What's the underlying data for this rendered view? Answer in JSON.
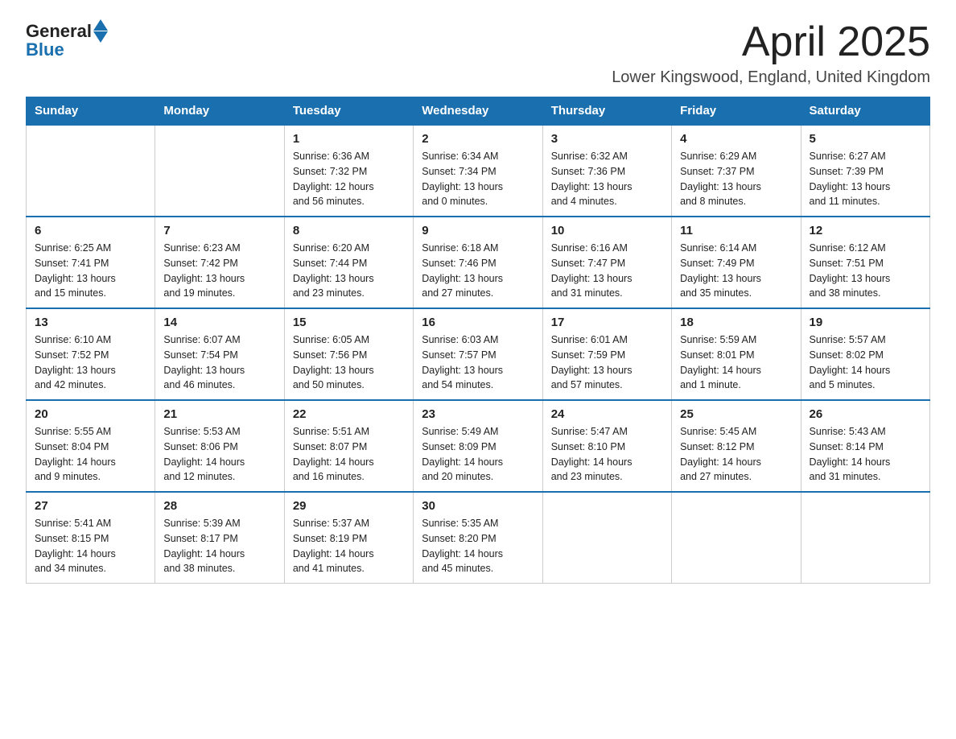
{
  "logo": {
    "general": "General",
    "blue": "Blue"
  },
  "title": "April 2025",
  "location": "Lower Kingswood, England, United Kingdom",
  "weekdays": [
    "Sunday",
    "Monday",
    "Tuesday",
    "Wednesday",
    "Thursday",
    "Friday",
    "Saturday"
  ],
  "weeks": [
    [
      {
        "day": "",
        "info": ""
      },
      {
        "day": "",
        "info": ""
      },
      {
        "day": "1",
        "info": "Sunrise: 6:36 AM\nSunset: 7:32 PM\nDaylight: 12 hours\nand 56 minutes."
      },
      {
        "day": "2",
        "info": "Sunrise: 6:34 AM\nSunset: 7:34 PM\nDaylight: 13 hours\nand 0 minutes."
      },
      {
        "day": "3",
        "info": "Sunrise: 6:32 AM\nSunset: 7:36 PM\nDaylight: 13 hours\nand 4 minutes."
      },
      {
        "day": "4",
        "info": "Sunrise: 6:29 AM\nSunset: 7:37 PM\nDaylight: 13 hours\nand 8 minutes."
      },
      {
        "day": "5",
        "info": "Sunrise: 6:27 AM\nSunset: 7:39 PM\nDaylight: 13 hours\nand 11 minutes."
      }
    ],
    [
      {
        "day": "6",
        "info": "Sunrise: 6:25 AM\nSunset: 7:41 PM\nDaylight: 13 hours\nand 15 minutes."
      },
      {
        "day": "7",
        "info": "Sunrise: 6:23 AM\nSunset: 7:42 PM\nDaylight: 13 hours\nand 19 minutes."
      },
      {
        "day": "8",
        "info": "Sunrise: 6:20 AM\nSunset: 7:44 PM\nDaylight: 13 hours\nand 23 minutes."
      },
      {
        "day": "9",
        "info": "Sunrise: 6:18 AM\nSunset: 7:46 PM\nDaylight: 13 hours\nand 27 minutes."
      },
      {
        "day": "10",
        "info": "Sunrise: 6:16 AM\nSunset: 7:47 PM\nDaylight: 13 hours\nand 31 minutes."
      },
      {
        "day": "11",
        "info": "Sunrise: 6:14 AM\nSunset: 7:49 PM\nDaylight: 13 hours\nand 35 minutes."
      },
      {
        "day": "12",
        "info": "Sunrise: 6:12 AM\nSunset: 7:51 PM\nDaylight: 13 hours\nand 38 minutes."
      }
    ],
    [
      {
        "day": "13",
        "info": "Sunrise: 6:10 AM\nSunset: 7:52 PM\nDaylight: 13 hours\nand 42 minutes."
      },
      {
        "day": "14",
        "info": "Sunrise: 6:07 AM\nSunset: 7:54 PM\nDaylight: 13 hours\nand 46 minutes."
      },
      {
        "day": "15",
        "info": "Sunrise: 6:05 AM\nSunset: 7:56 PM\nDaylight: 13 hours\nand 50 minutes."
      },
      {
        "day": "16",
        "info": "Sunrise: 6:03 AM\nSunset: 7:57 PM\nDaylight: 13 hours\nand 54 minutes."
      },
      {
        "day": "17",
        "info": "Sunrise: 6:01 AM\nSunset: 7:59 PM\nDaylight: 13 hours\nand 57 minutes."
      },
      {
        "day": "18",
        "info": "Sunrise: 5:59 AM\nSunset: 8:01 PM\nDaylight: 14 hours\nand 1 minute."
      },
      {
        "day": "19",
        "info": "Sunrise: 5:57 AM\nSunset: 8:02 PM\nDaylight: 14 hours\nand 5 minutes."
      }
    ],
    [
      {
        "day": "20",
        "info": "Sunrise: 5:55 AM\nSunset: 8:04 PM\nDaylight: 14 hours\nand 9 minutes."
      },
      {
        "day": "21",
        "info": "Sunrise: 5:53 AM\nSunset: 8:06 PM\nDaylight: 14 hours\nand 12 minutes."
      },
      {
        "day": "22",
        "info": "Sunrise: 5:51 AM\nSunset: 8:07 PM\nDaylight: 14 hours\nand 16 minutes."
      },
      {
        "day": "23",
        "info": "Sunrise: 5:49 AM\nSunset: 8:09 PM\nDaylight: 14 hours\nand 20 minutes."
      },
      {
        "day": "24",
        "info": "Sunrise: 5:47 AM\nSunset: 8:10 PM\nDaylight: 14 hours\nand 23 minutes."
      },
      {
        "day": "25",
        "info": "Sunrise: 5:45 AM\nSunset: 8:12 PM\nDaylight: 14 hours\nand 27 minutes."
      },
      {
        "day": "26",
        "info": "Sunrise: 5:43 AM\nSunset: 8:14 PM\nDaylight: 14 hours\nand 31 minutes."
      }
    ],
    [
      {
        "day": "27",
        "info": "Sunrise: 5:41 AM\nSunset: 8:15 PM\nDaylight: 14 hours\nand 34 minutes."
      },
      {
        "day": "28",
        "info": "Sunrise: 5:39 AM\nSunset: 8:17 PM\nDaylight: 14 hours\nand 38 minutes."
      },
      {
        "day": "29",
        "info": "Sunrise: 5:37 AM\nSunset: 8:19 PM\nDaylight: 14 hours\nand 41 minutes."
      },
      {
        "day": "30",
        "info": "Sunrise: 5:35 AM\nSunset: 8:20 PM\nDaylight: 14 hours\nand 45 minutes."
      },
      {
        "day": "",
        "info": ""
      },
      {
        "day": "",
        "info": ""
      },
      {
        "day": "",
        "info": ""
      }
    ]
  ]
}
